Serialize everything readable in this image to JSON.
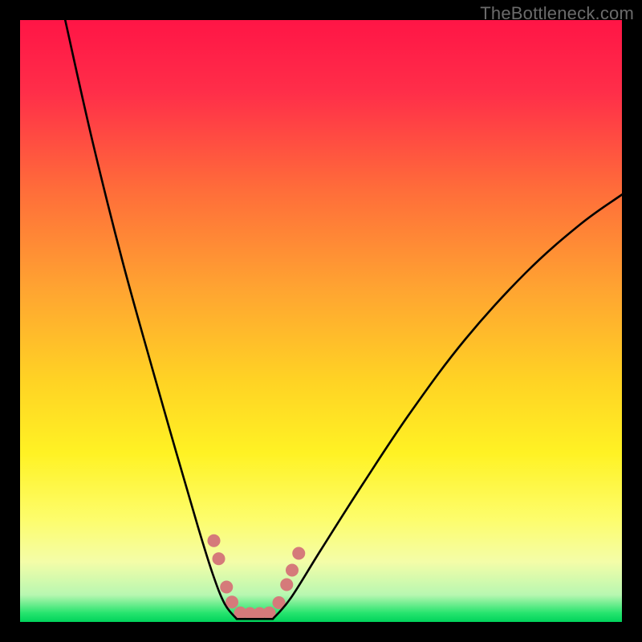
{
  "watermark": "TheBottleneck.com",
  "chart_data": {
    "type": "line",
    "title": "",
    "xlabel": "",
    "ylabel": "",
    "xlim": [
      0,
      100
    ],
    "ylim": [
      0,
      100
    ],
    "grid": false,
    "legend": false,
    "background_gradient": {
      "stops": [
        {
          "pos": 0.0,
          "color": "#ff1546"
        },
        {
          "pos": 0.12,
          "color": "#ff2e49"
        },
        {
          "pos": 0.28,
          "color": "#ff6c3a"
        },
        {
          "pos": 0.45,
          "color": "#ffa531"
        },
        {
          "pos": 0.6,
          "color": "#ffd324"
        },
        {
          "pos": 0.72,
          "color": "#fff224"
        },
        {
          "pos": 0.83,
          "color": "#fdfd6c"
        },
        {
          "pos": 0.9,
          "color": "#f4fda8"
        },
        {
          "pos": 0.955,
          "color": "#b8f7b1"
        },
        {
          "pos": 0.985,
          "color": "#27e46e"
        },
        {
          "pos": 1.0,
          "color": "#00d35b"
        }
      ]
    },
    "series": [
      {
        "name": "bottleneck-curve-left",
        "color": "#000000",
        "points": [
          {
            "x": 7.5,
            "y": 100
          },
          {
            "x": 12,
            "y": 80
          },
          {
            "x": 17,
            "y": 60
          },
          {
            "x": 22,
            "y": 42
          },
          {
            "x": 26,
            "y": 28
          },
          {
            "x": 29.5,
            "y": 16
          },
          {
            "x": 32,
            "y": 8
          },
          {
            "x": 34,
            "y": 3
          },
          {
            "x": 36,
            "y": 0.5
          }
        ]
      },
      {
        "name": "bottleneck-curve-right",
        "color": "#000000",
        "points": [
          {
            "x": 42,
            "y": 0.5
          },
          {
            "x": 45,
            "y": 4
          },
          {
            "x": 50,
            "y": 12
          },
          {
            "x": 57,
            "y": 23
          },
          {
            "x": 65,
            "y": 35
          },
          {
            "x": 74,
            "y": 47
          },
          {
            "x": 84,
            "y": 58
          },
          {
            "x": 93,
            "y": 66
          },
          {
            "x": 100,
            "y": 71
          }
        ]
      },
      {
        "name": "bottleneck-floor",
        "color": "#000000",
        "points": [
          {
            "x": 36,
            "y": 0.5
          },
          {
            "x": 42,
            "y": 0.5
          }
        ]
      }
    ],
    "markers": {
      "name": "highlight-dots",
      "color": "#d57a7a",
      "radius_px": 8,
      "points": [
        {
          "x": 32.2,
          "y": 13.5
        },
        {
          "x": 33.0,
          "y": 10.5
        },
        {
          "x": 34.3,
          "y": 5.8
        },
        {
          "x": 35.2,
          "y": 3.3
        },
        {
          "x": 36.6,
          "y": 1.5
        },
        {
          "x": 38.2,
          "y": 1.4
        },
        {
          "x": 39.8,
          "y": 1.4
        },
        {
          "x": 41.4,
          "y": 1.5
        },
        {
          "x": 43.0,
          "y": 3.2
        },
        {
          "x": 44.3,
          "y": 6.2
        },
        {
          "x": 45.2,
          "y": 8.6
        },
        {
          "x": 46.3,
          "y": 11.4
        }
      ]
    }
  }
}
